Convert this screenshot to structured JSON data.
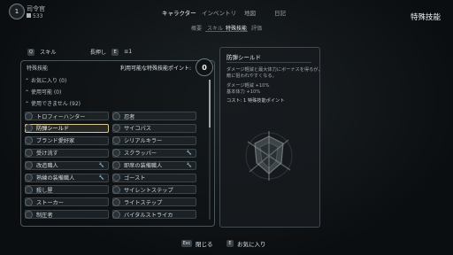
{
  "header": {
    "avatar_text": "1",
    "rank": "司令官",
    "currency": "533",
    "page_title": "特殊技能"
  },
  "tabs": [
    {
      "label": "キャラクター",
      "active": true
    },
    {
      "label": "インベントリ",
      "active": false
    },
    {
      "label": "地図",
      "active": false
    },
    {
      "label": "日記",
      "active": false
    }
  ],
  "subtabs": [
    {
      "label": "概要",
      "active": false
    },
    {
      "label": "スキル",
      "active": false
    },
    {
      "label": "特殊技能",
      "active": true
    },
    {
      "label": "評価",
      "active": false
    }
  ],
  "skillbar": {
    "key_skill": "Q",
    "skill_label": "スキル",
    "hold_label": "長押し",
    "key_hold": "E",
    "hold_icon": "≡1"
  },
  "list_panel": {
    "title": "特殊技能",
    "points_label": "利用可能な特殊技能ポイント:",
    "points_value": "0",
    "filters": [
      "お気に入り (0)",
      "使用可能 (0)",
      "使用できません (92)"
    ]
  },
  "skills": [
    {
      "left": "トロフィーハンター",
      "right": "忍者",
      "left_wrench": false,
      "right_wrench": false
    },
    {
      "left": "防弾シールド",
      "right": "サイコパス",
      "left_wrench": false,
      "right_wrench": false
    },
    {
      "left": "ブランド愛好家",
      "right": "シリアルキラー",
      "left_wrench": false,
      "right_wrench": false
    },
    {
      "left": "受け流す",
      "right": "スクラッパー",
      "left_wrench": false,
      "right_wrench": true
    },
    {
      "left": "改造職人",
      "right": "即席の装備職人",
      "left_wrench": true,
      "right_wrench": true
    },
    {
      "left": "熟練の装備職人",
      "right": "ゴースト",
      "left_wrench": true,
      "right_wrench": false
    },
    {
      "left": "殺し屋",
      "right": "サイレントステップ",
      "left_wrench": false,
      "right_wrench": false
    },
    {
      "left": "ストーカー",
      "right": "ライトステップ",
      "left_wrench": false,
      "right_wrench": false
    },
    {
      "left": "制圧者",
      "right": "バイタルストライカ",
      "left_wrench": false,
      "right_wrench": false
    }
  ],
  "detail": {
    "title": "防弾シールド",
    "desc1": "ダメージ軽減と最大体力にボーナスを得るが、",
    "desc2": "敵に狙われやすくなる。",
    "stat1": "ダメージ軽減 +10%",
    "stat2": "基本体力 +10%",
    "cost": "コスト: 1 特殊技能ポイント"
  },
  "bottom": {
    "close_key": "Esc",
    "close_label": "閉じる",
    "fav_key": "E",
    "fav_label": "お気に入り"
  }
}
